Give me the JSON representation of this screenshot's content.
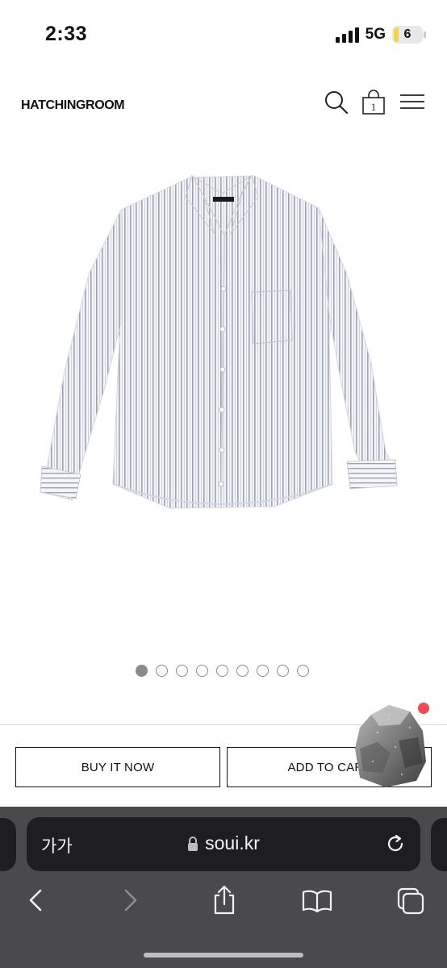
{
  "status_bar": {
    "time": "2:33",
    "network": "5G",
    "battery": "6"
  },
  "header": {
    "logo": "HATCHINGROOM",
    "cart_count": "1",
    "icons": [
      "search-icon",
      "cart-icon",
      "menu-icon"
    ]
  },
  "product": {
    "image_count": 9,
    "active_image": 1
  },
  "actions": {
    "buy_now": "BUY IT NOW",
    "add_to_cart": "ADD TO CART"
  },
  "browser": {
    "text_size_button": "가가",
    "url": "soui.kr",
    "toolbar_icons": [
      "back-icon",
      "forward-icon",
      "share-icon",
      "bookmarks-icon",
      "tabs-icon"
    ]
  },
  "colors": {
    "accent_badge": "#ef4a55",
    "chrome_bg": "#4a4a4c",
    "battery": "#f2d34a"
  }
}
